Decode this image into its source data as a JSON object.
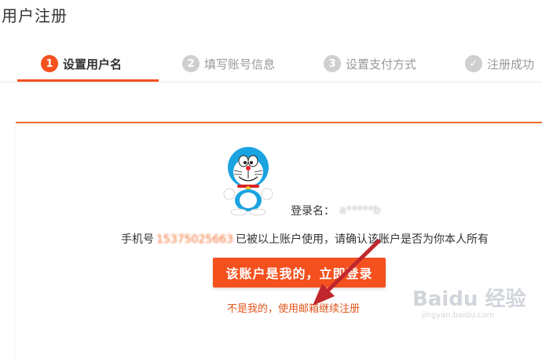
{
  "page": {
    "title": "用户注册"
  },
  "steps": [
    {
      "num": "1",
      "label": "设置用户名",
      "state": "active"
    },
    {
      "num": "2",
      "label": "填写账号信息",
      "state": "pending"
    },
    {
      "num": "3",
      "label": "设置支付方式",
      "state": "pending"
    },
    {
      "num": "✓",
      "label": "注册成功",
      "state": "pending"
    }
  ],
  "account": {
    "login_label": "登录名：",
    "login_value_masked": "a*****b",
    "phone_prefix": "手机号",
    "phone_masked": "15375025663",
    "phone_suffix": "已被以上账户使用，请确认该账户是否为你本人所有"
  },
  "actions": {
    "confirm_label": "该账户是我的，立即登录",
    "alt_link": "不是我的，使用邮箱继续注册"
  },
  "watermark": {
    "brand": "Baidu 经验",
    "site": "jingyan.baidu.com"
  },
  "colors": {
    "accent": "#f4511e",
    "link": "#e1541a",
    "step_inactive": "#cfcfcf",
    "arrow": "#c0272d"
  },
  "icons": {
    "avatar": "doraemon-avatar",
    "step_done": "check-circle-icon",
    "annotation": "red-arrow"
  }
}
